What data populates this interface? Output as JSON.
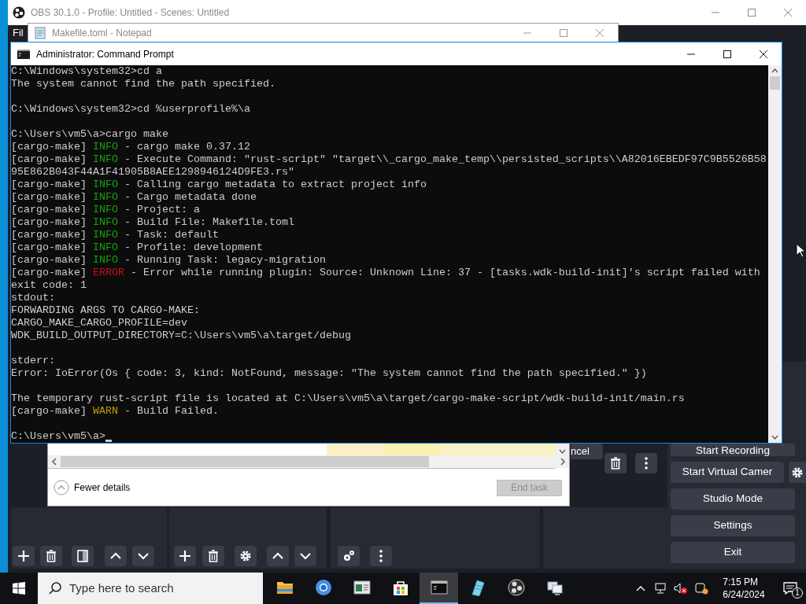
{
  "obs": {
    "title": "OBS 30.1.0 - Profile: Untitled - Scenes: Untitled",
    "menu": [
      "Fil"
    ],
    "partial_button": "ncel",
    "controls": [
      {
        "label": "Start Recording",
        "settings": false
      },
      {
        "label": "Start Virtual Camer",
        "settings": true
      },
      {
        "label": "Studio Mode",
        "settings": false
      },
      {
        "label": "Settings",
        "settings": false
      },
      {
        "label": "Exit",
        "settings": false
      }
    ]
  },
  "notepad": {
    "title": "Makefile.toml - Notepad"
  },
  "task_manager": {
    "toggle": "Fewer details",
    "end_task": {
      "label": "End task",
      "disabled": true
    }
  },
  "cmd": {
    "title": "Administrator: Command Prompt",
    "blocks": [
      [
        {
          "text": "C:\\Windows\\system32>cd a"
        },
        {
          "text": "The system cannot find the path specified."
        }
      ],
      [
        {
          "text": "C:\\Windows\\system32>cd %userprofile%\\a"
        }
      ],
      [
        {
          "text": "C:\\Users\\vm5\\a>cargo make"
        },
        {
          "source": "[cargo-make]",
          "level": "INFO",
          "kind": "info",
          "text": "- cargo make 0.37.12"
        },
        {
          "source": "[cargo-make]",
          "level": "INFO",
          "kind": "info",
          "text": "- Execute Command: \"rust-script\" \"target\\\\_cargo_make_temp\\\\persisted_scripts\\\\A82016EBEDF97C9B5526B58"
        },
        {
          "text": "95E862B043F44A1F41905B8AEE1298946124D9FE3.rs\""
        },
        {
          "source": "[cargo-make]",
          "level": "INFO",
          "kind": "info",
          "text": "- Calling cargo metadata to extract project info"
        },
        {
          "source": "[cargo-make]",
          "level": "INFO",
          "kind": "info",
          "text": "- Cargo metadata done"
        },
        {
          "source": "[cargo-make]",
          "level": "INFO",
          "kind": "info",
          "text": "- Project: a"
        },
        {
          "source": "[cargo-make]",
          "level": "INFO",
          "kind": "info",
          "text": "- Build File: Makefile.toml"
        },
        {
          "source": "[cargo-make]",
          "level": "INFO",
          "kind": "info",
          "text": "- Task: default"
        },
        {
          "source": "[cargo-make]",
          "level": "INFO",
          "kind": "info",
          "text": "- Profile: development"
        },
        {
          "source": "[cargo-make]",
          "level": "INFO",
          "kind": "info",
          "text": "- Running Task: legacy-migration"
        },
        {
          "source": "[cargo-make]",
          "level": "ERROR",
          "kind": "error",
          "text": "- Error while running plugin: Source: Unknown Line: 37 - [tasks.wdk-build-init]'s script failed with"
        },
        {
          "text": "exit code: 1"
        },
        {
          "text": "stdout:"
        },
        {
          "text": "FORWARDING ARGS TO CARGO-MAKE:"
        },
        {
          "text": "CARGO_MAKE_CARGO_PROFILE=dev"
        },
        {
          "text": "WDK_BUILD_OUTPUT_DIRECTORY=C:\\Users\\vm5\\a\\target/debug"
        }
      ],
      [
        {
          "text": "stderr:"
        },
        {
          "text": "Error: IoError(Os { code: 3, kind: NotFound, message: \"The system cannot find the path specified.\" })"
        }
      ],
      [
        {
          "text": "The temporary rust-script file is located at C:\\Users\\vm5\\a\\target/cargo-make-script/wdk-build-init/main.rs"
        },
        {
          "source": "[cargo-make]",
          "level": "WARN",
          "kind": "warn",
          "text": "- Build Failed."
        }
      ]
    ],
    "prompt": {
      "text": "C:\\Users\\vm5\\a>",
      "cursor": true
    }
  },
  "taskbar": {
    "search": {
      "placeholder": "Type here to search"
    },
    "apps": [
      {
        "kind": "folder",
        "selected": false
      },
      {
        "kind": "browser",
        "selected": false
      },
      {
        "kind": "window",
        "selected": false
      },
      {
        "kind": "store",
        "selected": false
      },
      {
        "kind": "terminal",
        "selected": true
      },
      {
        "kind": "notepad",
        "selected": false
      },
      {
        "kind": "obs",
        "selected": false
      },
      {
        "kind": "remote",
        "selected": false
      }
    ],
    "time": "7:15 PM",
    "date": "6/24/2024",
    "notifications": "1"
  }
}
